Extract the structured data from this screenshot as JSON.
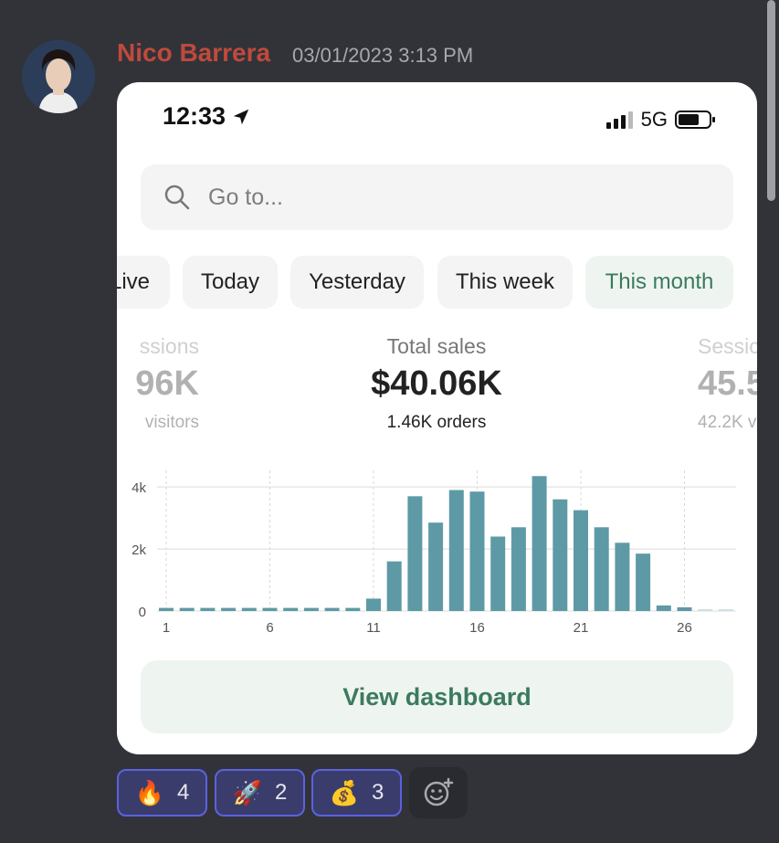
{
  "message": {
    "author": "Nico Barrera",
    "timestamp": "03/01/2023 3:13 PM"
  },
  "phone": {
    "time": "12:33",
    "network": "5G"
  },
  "search": {
    "placeholder": "Go to..."
  },
  "filters": [
    {
      "label": "Live"
    },
    {
      "label": "Today"
    },
    {
      "label": "Yesterday"
    },
    {
      "label": "This week"
    },
    {
      "label": "This month",
      "selected": true
    }
  ],
  "metrics": {
    "left": {
      "label": "ssions",
      "value": "96K",
      "sub": "visitors"
    },
    "center": {
      "label": "Total sales",
      "value": "$40.06K",
      "sub": "1.46K orders"
    },
    "right": {
      "label": "Sessic",
      "value": "45.5",
      "sub": "42.2K v"
    }
  },
  "chart_data": {
    "type": "bar",
    "x": [
      1,
      2,
      3,
      4,
      5,
      6,
      7,
      8,
      9,
      10,
      11,
      12,
      13,
      14,
      15,
      16,
      17,
      18,
      19,
      20,
      21,
      22,
      23,
      24,
      25,
      26,
      27,
      28
    ],
    "values": [
      100,
      100,
      100,
      100,
      100,
      100,
      100,
      100,
      100,
      100,
      400,
      1600,
      3700,
      2850,
      3900,
      3850,
      2400,
      2700,
      4350,
      3600,
      3250,
      2700,
      2200,
      1850,
      180,
      120,
      50,
      50
    ],
    "x_ticks": [
      "1",
      "6",
      "11",
      "16",
      "21",
      "26"
    ],
    "y_ticks": [
      "0",
      "2k",
      "4k"
    ],
    "ylim": [
      0,
      4000
    ],
    "color": "#5e9aa6"
  },
  "cta": {
    "label": "View dashboard"
  },
  "reactions": [
    {
      "emoji": "🔥",
      "count": "4"
    },
    {
      "emoji": "🚀",
      "count": "2"
    },
    {
      "emoji": "💰",
      "count": "3"
    }
  ],
  "colors": {
    "accent": "#3c7a5e",
    "author": "#bf4a3c",
    "reaction_border": "#5b62e0"
  }
}
